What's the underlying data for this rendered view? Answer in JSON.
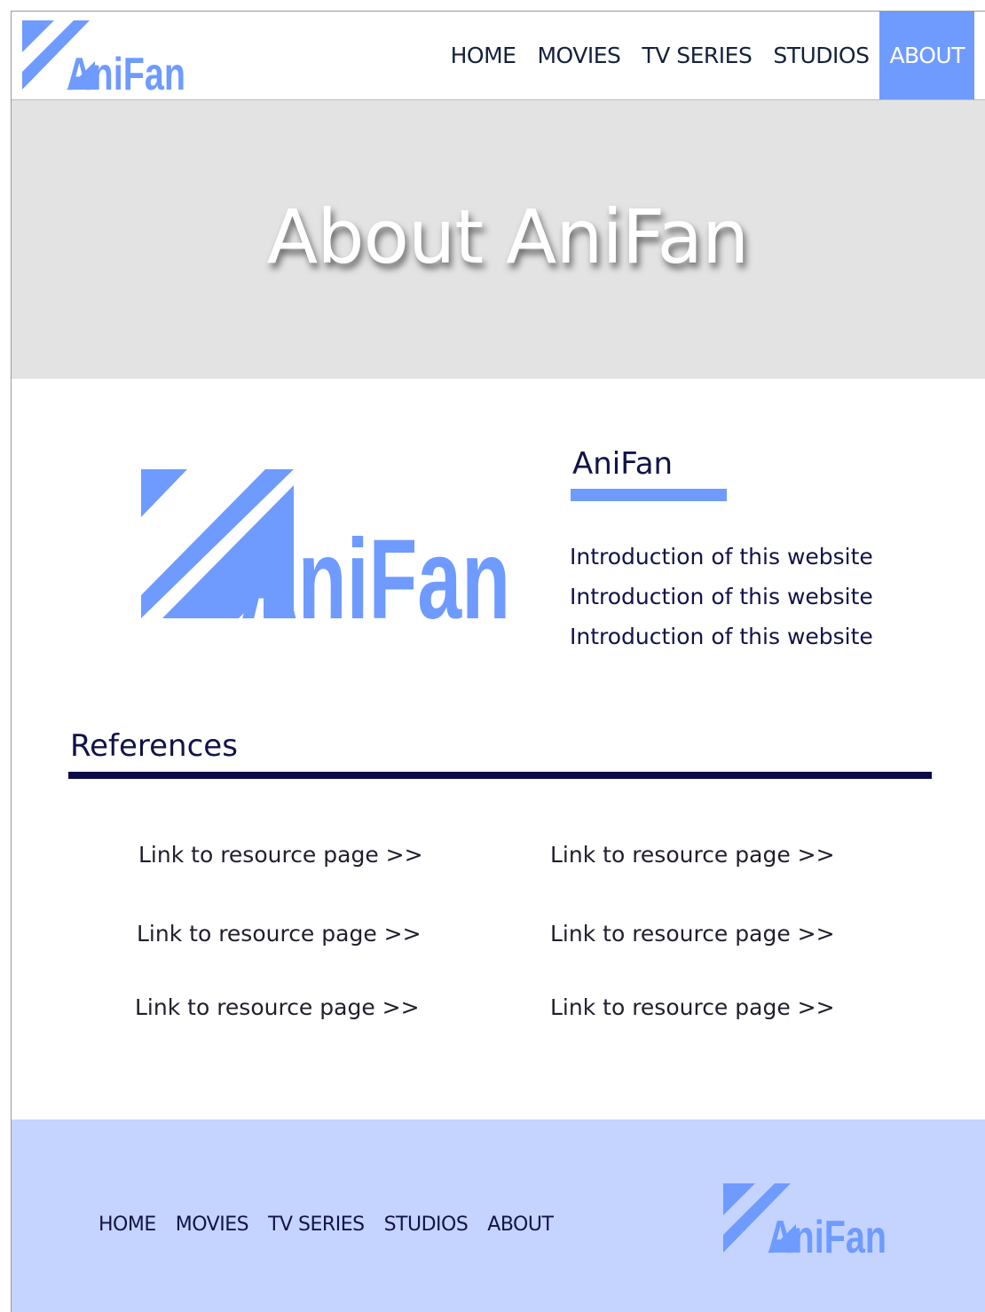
{
  "header": {
    "logo_text": "AniFan",
    "nav": [
      "HOME",
      "MOVIES",
      "TV SERIES",
      "STUDIOS",
      "ABOUT"
    ],
    "active": "ABOUT"
  },
  "banner": {
    "title": "About AniFan"
  },
  "intro": {
    "title": "AniFan",
    "lines": [
      "Introduction of this website",
      "Introduction of this website",
      "Introduction of this website"
    ]
  },
  "references": {
    "title": "References",
    "links": [
      "Link to resource page  >>",
      "Link to resource page  >>",
      "Link to resource page  >>",
      "Link to resource page  >>",
      "Link to resource page  >>",
      "Link to resource page  >>"
    ]
  },
  "footer": {
    "nav": [
      "HOME",
      "MOVIES",
      "TV SERIES",
      "STUDIOS",
      "ABOUT"
    ],
    "logo_text": "AniFan"
  },
  "colors": {
    "accent": "#6f9bff",
    "navy": "#0b0b48",
    "banner": "#e3e3e3",
    "footer": "#c4d4ff"
  }
}
